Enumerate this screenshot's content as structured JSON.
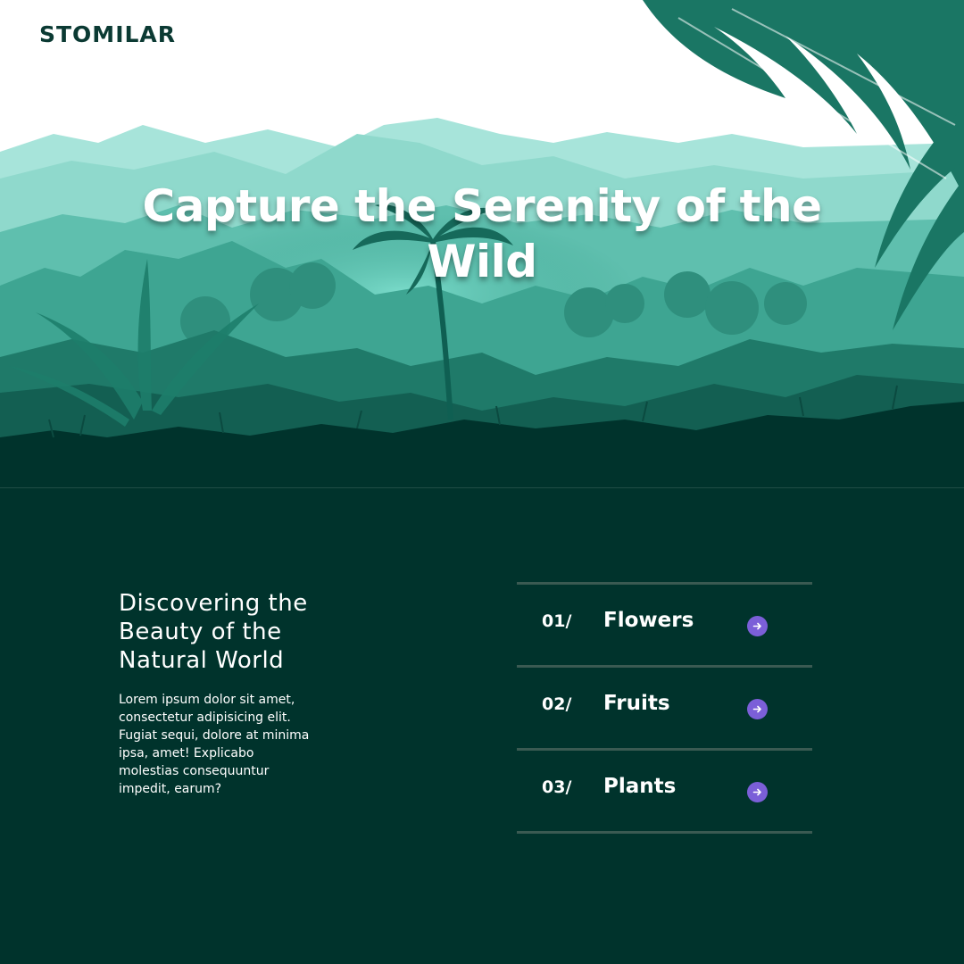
{
  "brand": {
    "logo_text": "STOMILAR"
  },
  "hero": {
    "title": "Capture the Serenity of the Wild",
    "colors": {
      "sky": "#ffffff",
      "mist": "#8fdccd",
      "forest_mid": "#3aa391",
      "forest_dark": "#0f5a4c",
      "ground": "#00332c"
    }
  },
  "intro": {
    "heading": "Discovering the Beauty of the Natural World",
    "body": "Lorem ipsum dolor sit amet, consectetur adipisicing elit. Fugiat sequi, dolore at minima ipsa, amet! Explicabo molestias consequuntur impedit, earum?"
  },
  "categories": [
    {
      "number": "01/",
      "label": "Flowers",
      "icon": "arrow-right-icon"
    },
    {
      "number": "02/",
      "label": "Fruits",
      "icon": "arrow-right-icon"
    },
    {
      "number": "03/",
      "label": "Plants",
      "icon": "arrow-right-icon"
    }
  ],
  "colors": {
    "background": "#00332c",
    "accent": "#7b5fd8",
    "divider": "#3a5a52"
  }
}
